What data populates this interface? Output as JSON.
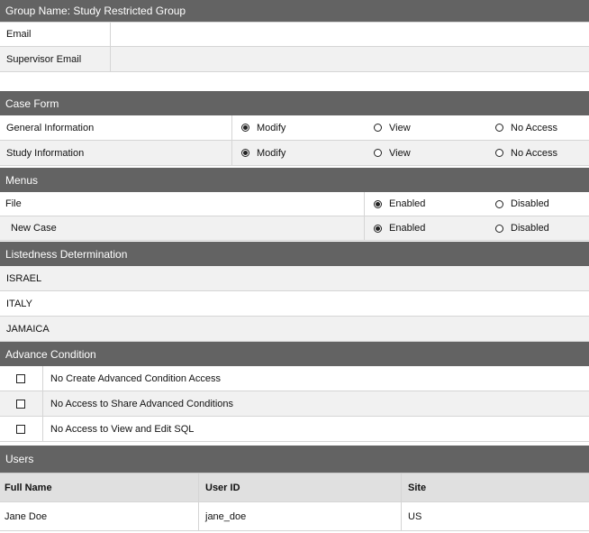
{
  "group_name": "Group Name: Study Restricted Group",
  "contact": {
    "email_label": "Email",
    "email_value": "",
    "supervisor_email_label": "Supervisor Email",
    "supervisor_email_value": ""
  },
  "case_form": {
    "title": "Case Form",
    "options": [
      "Modify",
      "View",
      "No Access"
    ],
    "rows": [
      {
        "label": "General Information",
        "selected": "Modify"
      },
      {
        "label": "Study Information",
        "selected": "Modify"
      }
    ]
  },
  "menus": {
    "title": "Menus",
    "options": [
      "Enabled",
      "Disabled"
    ],
    "rows": [
      {
        "label": "File",
        "selected": "Enabled"
      },
      {
        "label": "New Case",
        "selected": "Enabled"
      }
    ]
  },
  "listedness": {
    "title": "Listedness Determination",
    "items": [
      "ISRAEL",
      "ITALY",
      "JAMAICA"
    ]
  },
  "advance_condition": {
    "title": "Advance Condition",
    "items": [
      {
        "label": "No Create Advanced Condition Access",
        "checked": false
      },
      {
        "label": "No Access to Share Advanced Conditions",
        "checked": false
      },
      {
        "label": "No Access to View and Edit SQL",
        "checked": false
      }
    ]
  },
  "users": {
    "title": "Users",
    "columns": [
      "Full Name",
      "User ID",
      "Site"
    ],
    "rows": [
      [
        "Jane Doe",
        "jane_doe",
        "US"
      ]
    ]
  },
  "colors": {
    "header_bg": "#636363",
    "row_alt": "#f1f1f1",
    "border": "#d5d5d5"
  }
}
